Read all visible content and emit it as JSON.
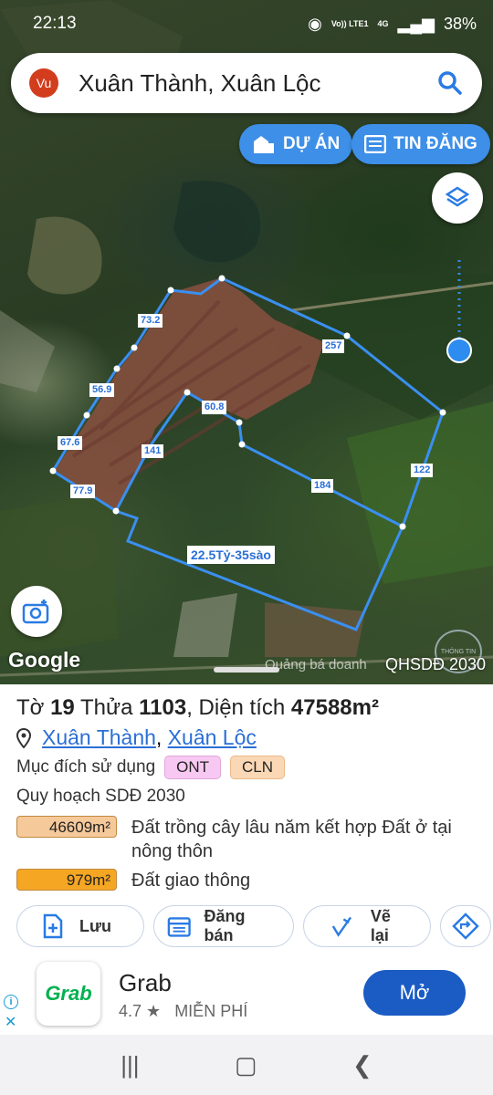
{
  "status": {
    "time": "22:13",
    "battery": "38%",
    "net": "4G",
    "volte": "Vo)) LTE1"
  },
  "search": {
    "avatar": "Vu",
    "query": "Xuân Thành, Xuân Lộc"
  },
  "buttons": {
    "projects": "DỰ ÁN",
    "listings": "TIN ĐĂNG"
  },
  "map": {
    "edge_labels": [
      "73.2",
      "257",
      "56.9",
      "60.8",
      "67.6",
      "141",
      "122",
      "184",
      "77.9"
    ],
    "parcel_label": "22.5Tỷ-35sào",
    "google": "Google",
    "promo": "Quảng bá doanh",
    "plan_name": "QHSDĐ 2030",
    "watermark": "THÔNG TIN"
  },
  "info": {
    "title_pre": "Tờ",
    "sheet": "19",
    "title_mid": "Thửa",
    "parcel": "1103",
    "title_area_label": ", Diện tích",
    "area": "47588m²",
    "commune": "Xuân Thành",
    "district": "Xuân Lộc",
    "purpose_label": "Mục đích sử dụng",
    "purpose_tags": [
      "ONT",
      "CLN"
    ],
    "plan_label": "Quy hoạch SDĐ 2030",
    "zones": [
      {
        "area": "46609m²",
        "desc": "Đất trồng cây lâu năm kết hợp Đất ở tại nông thôn",
        "color": "#f6c99a"
      },
      {
        "area": "979m²",
        "desc": "Đất giao thông",
        "color": "#f5a623"
      }
    ]
  },
  "actions": {
    "save": "Lưu",
    "sell": "Đăng bán",
    "redraw": "Vẽ lại"
  },
  "ad": {
    "brand": "Grab",
    "title": "Grab",
    "rating": "4.7 ★",
    "price": "MIỄN PHÍ",
    "cta": "Mở"
  },
  "colors": {
    "accent": "#3d8fe8",
    "parcel_line": "#3a8ff0",
    "cta": "#1a5bc4"
  }
}
